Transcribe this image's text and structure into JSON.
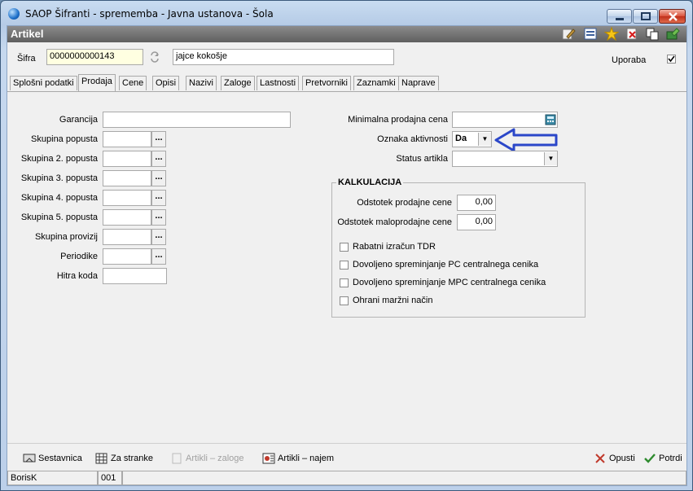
{
  "window": {
    "title": "SAOP Šifranti - sprememba - Javna ustanova - Šola",
    "controls": [
      "minimize",
      "maximize",
      "close"
    ]
  },
  "header": {
    "title": "Artikel",
    "toolbar_icons": [
      "edit-icon",
      "settings-icon",
      "star-icon",
      "delete-icon",
      "copy-icon",
      "export-icon"
    ]
  },
  "article": {
    "sifra_label": "Šifra",
    "sifra_value": "0000000000143",
    "name_value": "jajce kokošje",
    "uporaba_label": "Uporaba",
    "uporaba_checked": true
  },
  "tabs": [
    {
      "label": "Splošni podatki",
      "active": false
    },
    {
      "label": "Prodaja",
      "active": true
    },
    {
      "label": "Cene",
      "active": false
    },
    {
      "label": "Opisi",
      "active": false
    },
    {
      "label": "Nazivi",
      "active": false
    },
    {
      "label": "Zaloge",
      "active": false
    },
    {
      "label": "Lastnosti",
      "active": false
    },
    {
      "label": "Pretvorniki",
      "active": false
    },
    {
      "label": "Zaznamki",
      "active": false
    },
    {
      "label": "Naprave",
      "active": false
    }
  ],
  "left_fields": {
    "garancija": {
      "label": "Garancija",
      "value": ""
    },
    "skupina_popusta": {
      "label": "Skupina popusta",
      "value": ""
    },
    "skupina2": {
      "label": "Skupina 2. popusta",
      "value": ""
    },
    "skupina3": {
      "label": "Skupina 3. popusta",
      "value": ""
    },
    "skupina4": {
      "label": "Skupina 4. popusta",
      "value": ""
    },
    "skupina5": {
      "label": "Skupina 5. popusta",
      "value": ""
    },
    "provizij": {
      "label": "Skupina provizij",
      "value": ""
    },
    "periodike": {
      "label": "Periodike",
      "value": ""
    },
    "hitra_koda": {
      "label": "Hitra koda",
      "value": ""
    },
    "lookup_symbol": "..."
  },
  "right_fields": {
    "min_cena": {
      "label": "Minimalna prodajna cena",
      "value": ""
    },
    "oznaka": {
      "label": "Oznaka aktivnosti",
      "value": "Da"
    },
    "status": {
      "label": "Status artikla",
      "value": ""
    }
  },
  "kalkulacija": {
    "title": "KALKULACIJA",
    "odstotek_prodajne": {
      "label": "Odstotek prodajne cene",
      "value": "0,00"
    },
    "odstotek_maloprodajne": {
      "label": "Odstotek maloprodajne cene",
      "value": "0,00"
    },
    "checkboxes": [
      {
        "label": "Rabatni izračun TDR",
        "checked": false
      },
      {
        "label": "Dovoljeno spreminjanje PC centralnega cenika",
        "checked": false
      },
      {
        "label": "Dovoljeno spreminjanje MPC centralnega cenika",
        "checked": false
      },
      {
        "label": "Ohrani maržni način",
        "checked": false
      }
    ]
  },
  "annotation": {
    "color": "#2b47c9"
  },
  "footer": {
    "sestavnica": "Sestavnica",
    "za_stranke": "Za stranke",
    "artikli_zaloge": "Artikli – zaloge",
    "artikli_najem": "Artikli – najem",
    "opusti": "Opusti",
    "potrdi": "Potrdi"
  },
  "statusbar": {
    "user": "BorisK",
    "code": "001",
    "extra": ""
  }
}
